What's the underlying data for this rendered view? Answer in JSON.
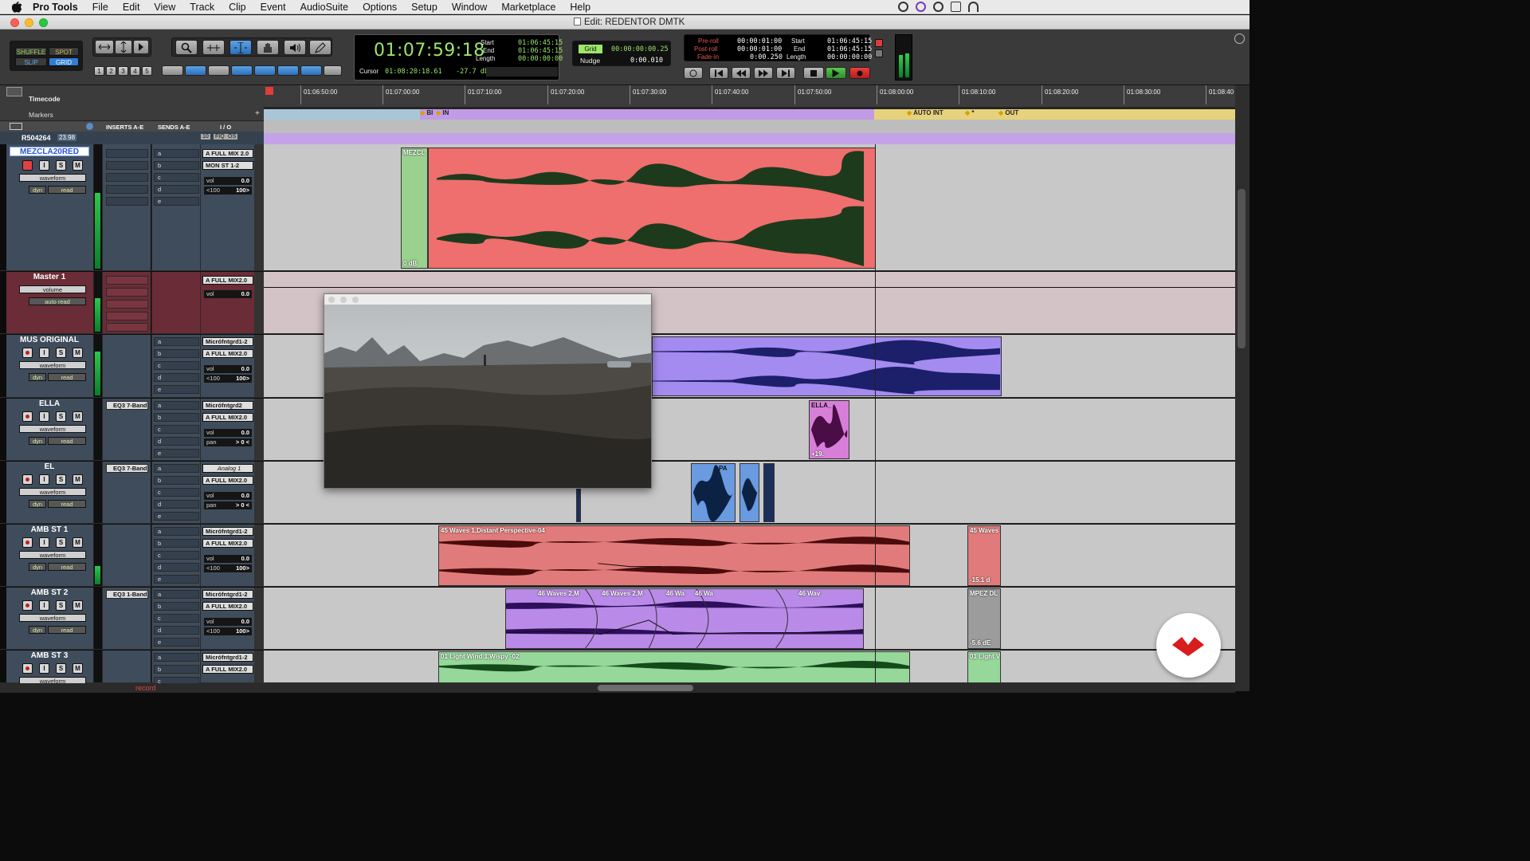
{
  "menubar": {
    "app": "Pro Tools",
    "items": [
      "File",
      "Edit",
      "View",
      "Track",
      "Clip",
      "Event",
      "AudioSuite",
      "Options",
      "Setup",
      "Window",
      "Marketplace",
      "Help"
    ]
  },
  "window": {
    "title": "Edit: REDENTOR DMTK"
  },
  "toolbar": {
    "edit_modes": [
      "SHUFFLE",
      "SPOT",
      "SLIP",
      "GRID"
    ],
    "zoom_presets": [
      "1",
      "2",
      "3",
      "4",
      "5"
    ],
    "main_counter": "01:07:59:18",
    "selection": {
      "start_label": "Start",
      "start": "01:06:45:15",
      "end_label": "End",
      "end": "01:06:45:15",
      "length_label": "Length",
      "length": "00:00:00:00"
    },
    "cursor_label": "Cursor",
    "cursor": "01:08:20:18.61",
    "cursor_db": "-27.7 db",
    "grid_label": "Grid",
    "grid_value": "00:00:00:00.25",
    "nudge_label": "Nudge",
    "nudge_value": "0:00.010",
    "preroll_label": "Pre-roll",
    "preroll": "00:00:01:00",
    "postroll_label": "Post-roll",
    "postroll": "00:00:01:00",
    "fadein_label": "Fade-in",
    "fadein": "0:00.250",
    "transport_sel": {
      "start_label": "Start",
      "start": "01:06:45:15",
      "end_label": "End",
      "end": "01:06:45:15",
      "length_label": "Length",
      "length": "00:00:00:00"
    }
  },
  "rulers": {
    "timecode_label": "Timecode",
    "markers_label": "Markers",
    "timecode_ticks": [
      "01:06:50:00",
      "01:07:00:00",
      "01:07:10:00",
      "01:07:20:00",
      "01:07:30:00",
      "01:07:40:00",
      "01:07:50:00",
      "01:08:00:00",
      "01:08:10:00",
      "01:08:20:00",
      "01:08:30:00",
      "01:08:40"
    ],
    "markers": [
      "BI",
      "IN",
      "AUTO INT",
      "*",
      "OUT"
    ]
  },
  "columns": {
    "inserts": "INSERTS A-E",
    "sends": "SENDS A-E",
    "io": "I / O"
  },
  "reel": {
    "name": "R504264",
    "fps": "23.98",
    "badges": [
      "10",
      "FIQ",
      "OS"
    ]
  },
  "tracks": [
    {
      "name": "MEZCLA20RED",
      "view": "waveform",
      "auto": "read",
      "dyn": "dyn",
      "inserts": [],
      "sends": [
        "a",
        "b",
        "c",
        "d",
        "e"
      ],
      "io": [
        "A FULL MIX 2.0",
        "MON ST 1-2"
      ],
      "vol": "0.0",
      "pan": [
        "<100",
        "100>"
      ],
      "selected": true
    },
    {
      "name": "Master 1",
      "view": "volume",
      "auto": "auto read",
      "inserts": [],
      "io": [
        "A FULL MIX2.0"
      ],
      "vol": "0.0"
    },
    {
      "name": "MUS ORIGINAL",
      "view": "waveform",
      "auto": "read",
      "dyn": "dyn",
      "inserts": [],
      "sends": [
        "a",
        "b",
        "c",
        "d",
        "e"
      ],
      "io": [
        "Micrófntgrd1-2",
        "A FULL MIX2.0"
      ],
      "vol": "0.0",
      "pan": [
        "<100",
        "100>"
      ]
    },
    {
      "name": "ELLA",
      "view": "waveform",
      "auto": "read",
      "dyn": "dyn",
      "inserts": [
        "EQ3 7-Band"
      ],
      "sends": [
        "a",
        "b",
        "c",
        "d",
        "e"
      ],
      "io": [
        "Micrófntgrd2",
        "A FULL MIX2.0"
      ],
      "vol": "0.0",
      "pan_label": "pan",
      "pan_val": "> 0 <"
    },
    {
      "name": "EL",
      "view": "waveform",
      "auto": "read",
      "dyn": "dyn",
      "inserts": [
        "EQ3 7-Band"
      ],
      "sends": [
        "a",
        "b",
        "c",
        "d",
        "e"
      ],
      "io": [
        "Analog 1",
        "A FULL MIX2.0"
      ],
      "vol": "0.0",
      "pan_label": "pan",
      "pan_val": "> 0 <"
    },
    {
      "name": "AMB ST 1",
      "view": "waveform",
      "auto": "read",
      "dyn": "dyn",
      "inserts": [],
      "sends": [
        "a",
        "b",
        "c",
        "d",
        "e"
      ],
      "io": [
        "Micrófntgrd1-2",
        "A FULL MIX2.0"
      ],
      "vol": "0.0",
      "pan": [
        "<100",
        "100>"
      ]
    },
    {
      "name": "AMB ST 2",
      "view": "waveform",
      "auto": "read",
      "dyn": "dyn",
      "inserts": [
        "EQ3 1-Band"
      ],
      "sends": [
        "a",
        "b",
        "c",
        "d",
        "e"
      ],
      "io": [
        "Micrófntgrd1-2",
        "A FULL MIX2.0"
      ],
      "vol": "0.0",
      "pan": [
        "<100",
        "100>"
      ]
    },
    {
      "name": "AMB ST 3",
      "view": "waveform",
      "auto": "read",
      "dyn": "dyn",
      "inserts": [],
      "sends": [
        "a",
        "b",
        "c"
      ],
      "io": [
        "Micrófntgrd1-2",
        "A FULL MIX2.0"
      ],
      "vol": "0.0"
    }
  ],
  "clips": {
    "mezcla": {
      "name": "MEZCL",
      "gain": "0 dB"
    },
    "ella": {
      "name": "ELLA_",
      "gain": "+19."
    },
    "el": {
      "name": "PA"
    },
    "amb1": {
      "name": "45 Waves 1,Distant Perspective-04",
      "name2": "45 Waves",
      "gain2": "-15.1 d"
    },
    "amb2": {
      "names": [
        "46 Waves 2,M",
        "46 Waves 2,M",
        "46 Wa",
        "46 Wa",
        "46 Wav"
      ],
      "name2": "MPEZ DL",
      "gain2": "-5.6 dE"
    },
    "amb3": {
      "name": "01 Light Wind 1,Wispy -02",
      "name2": "01 Light V"
    }
  },
  "bottom": {
    "record_label": "record"
  },
  "colors": {
    "accent": "#5aa2e6",
    "clip_red": "#ef6e6e",
    "clip_purple": "#a48bf0",
    "clip_green": "#95d89a"
  }
}
